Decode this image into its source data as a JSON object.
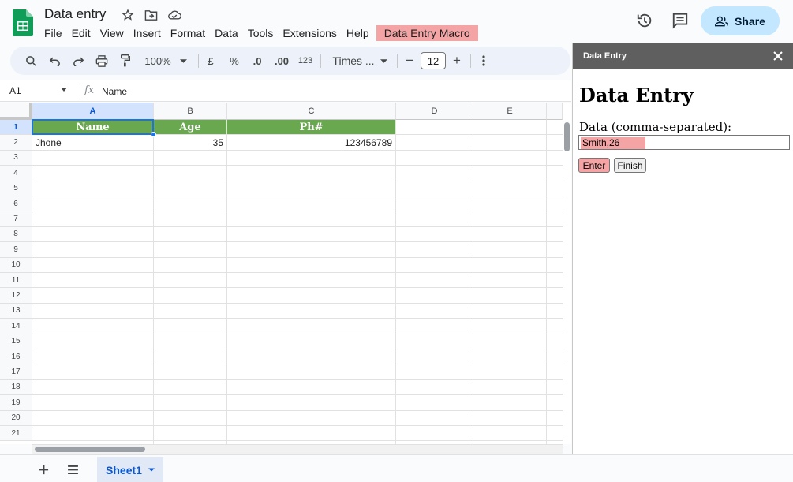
{
  "header": {
    "doc_title": "Data entry",
    "menus": [
      "File",
      "Edit",
      "View",
      "Insert",
      "Format",
      "Data",
      "Tools",
      "Extensions",
      "Help"
    ],
    "macro_menu": "Data Entry Macro",
    "share_label": "Share"
  },
  "toolbar": {
    "zoom": "100%",
    "currency": "£",
    "percent": "%",
    "dec_decrease": ".0",
    "dec_increase": ".00",
    "number_format": "123",
    "font": "Times ...",
    "font_size": "12",
    "minus": "−",
    "plus": "+"
  },
  "formula_bar": {
    "cell_ref": "A1",
    "fx": "fx",
    "content": "Name"
  },
  "grid": {
    "columns": [
      "A",
      "B",
      "C",
      "D",
      "E"
    ],
    "rows": [
      "1",
      "2",
      "3",
      "4",
      "5",
      "6",
      "7",
      "8",
      "9",
      "10",
      "11",
      "12",
      "13",
      "14",
      "15",
      "16",
      "17",
      "18",
      "19",
      "20",
      "21"
    ],
    "header_row": [
      "Name",
      "Age",
      "Ph#"
    ],
    "data_row": [
      "Jhone",
      "35",
      "123456789"
    ]
  },
  "bottom": {
    "sheet_name": "Sheet1"
  },
  "sidebar": {
    "title": "Data Entry",
    "heading": "Data Entry",
    "label": "Data (comma-separated):",
    "input_value": "Smith,26",
    "enter_label": "Enter",
    "finish_label": "Finish"
  }
}
